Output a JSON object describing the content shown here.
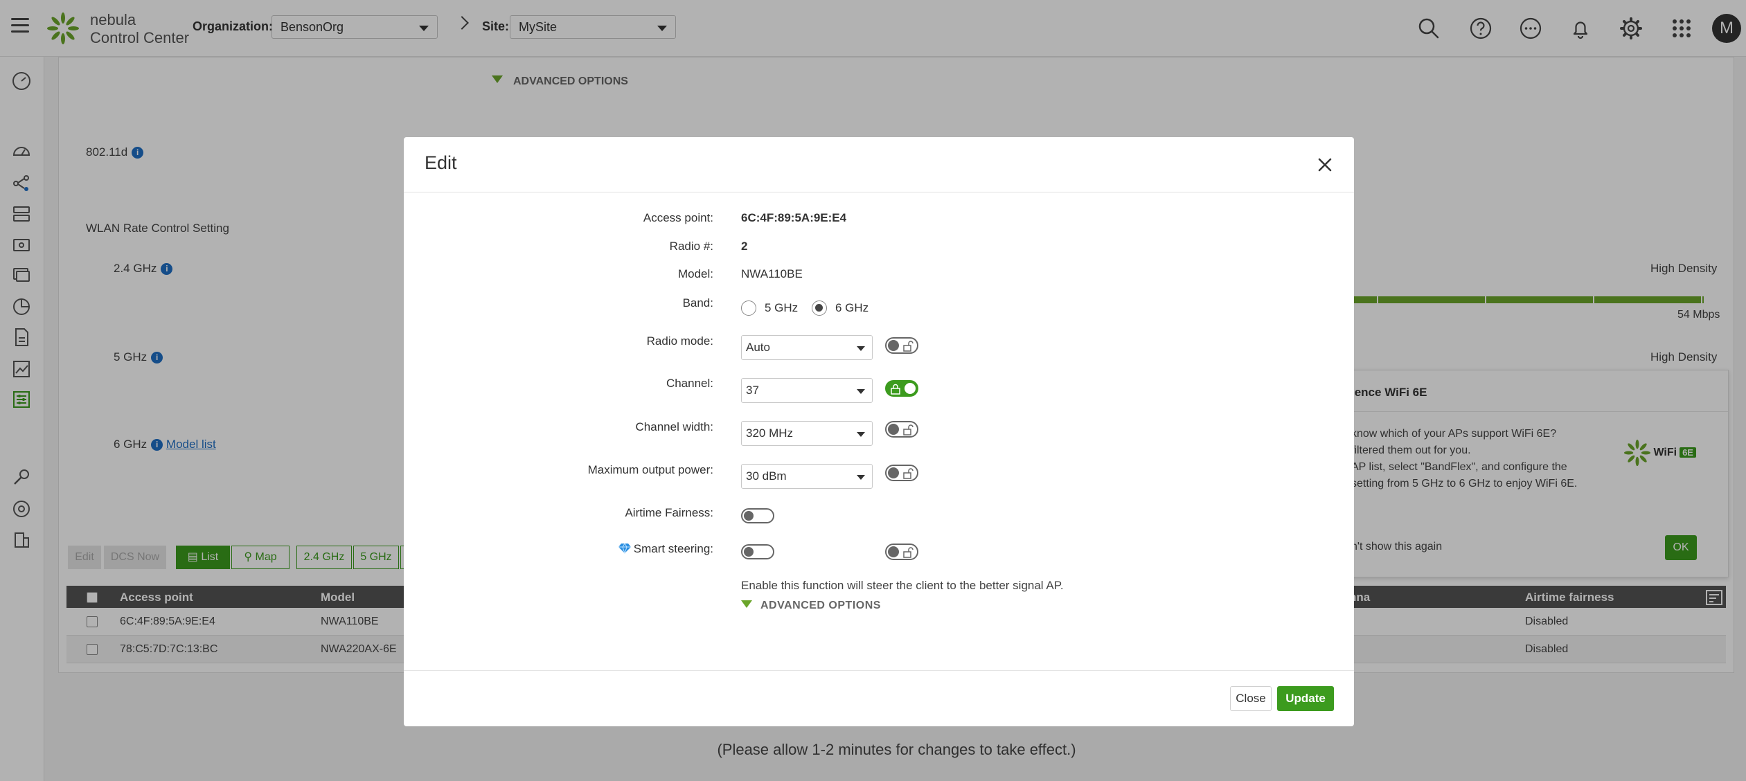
{
  "app": {
    "name_line1": "nebula",
    "name_line2": "Control Center",
    "organization_label": "Organization:",
    "organization_value": "BensonOrg",
    "site_label": "Site:",
    "site_value": "MySite",
    "avatar_initial": "M",
    "brand_color": "#3c9b1e"
  },
  "background": {
    "advanced_options": "ADVANCED OPTIONS",
    "dot11d_label": "802.11d",
    "wlan_rate_title": "WLAN Rate Control Setting",
    "band_24": "2.4 GHz",
    "band_5": "5 GHz",
    "band_6": "6 GHz",
    "model_list_link": "Model list",
    "high_density_1": "High Density",
    "high_density_2": "High Density",
    "rate_value": "54 Mbps",
    "popup": {
      "title": "ience WiFi 6E",
      "line1": "know which of your APs support WiFi 6E?",
      "line2": "filtered them out for you.",
      "line3": "AP list, select \"BandFlex\", and configure the",
      "line4": "setting from 5 GHz to 6 GHz to enjoy WiFi 6E.",
      "dont_show": "n't show this again",
      "ok_label": "OK",
      "badge_text": "WiFi",
      "badge_6e": "6E"
    },
    "toolbar": {
      "edit": "Edit",
      "dcs_now": "DCS Now",
      "list": "List",
      "map": "Map",
      "g24": "2.4 GHz",
      "g5": "5 GHz"
    },
    "table": {
      "headers": {
        "access_point": "Access point",
        "model": "Model",
        "antenna": "nna",
        "airtime_fairness": "Airtime fairness"
      },
      "rows": [
        {
          "access_point": "6C:4F:89:5A:9E:E4",
          "model": "NWA110BE",
          "airtime": "Disabled"
        },
        {
          "access_point": "78:C5:7D:7C:13:BC",
          "model": "NWA220AX-6E",
          "airtime": "Disabled"
        }
      ]
    },
    "note": "(Please allow 1-2 minutes for changes to take effect.)"
  },
  "modal": {
    "title": "Edit",
    "fields": {
      "access_point_label": "Access point:",
      "access_point_value": "6C:4F:89:5A:9E:E4",
      "radio_label": "Radio #:",
      "radio_value": "2",
      "model_label": "Model:",
      "model_value": "NWA110BE",
      "band_label": "Band:",
      "band_option_5": "5 GHz",
      "band_option_6": "6 GHz",
      "band_selected": "6 GHz",
      "radio_mode_label": "Radio mode:",
      "radio_mode_value": "Auto",
      "channel_label": "Channel:",
      "channel_value": "37",
      "channel_width_label": "Channel width:",
      "channel_width_value": "320 MHz",
      "max_power_label": "Maximum output power:",
      "max_power_value": "30 dBm",
      "airtime_label": "Airtime Fairness:",
      "smart_steering_label": "Smart steering:",
      "smart_steering_hint": "Enable this function will steer the client to the better signal AP.",
      "advanced_options": "ADVANCED OPTIONS"
    },
    "close_label": "Close",
    "update_label": "Update"
  }
}
